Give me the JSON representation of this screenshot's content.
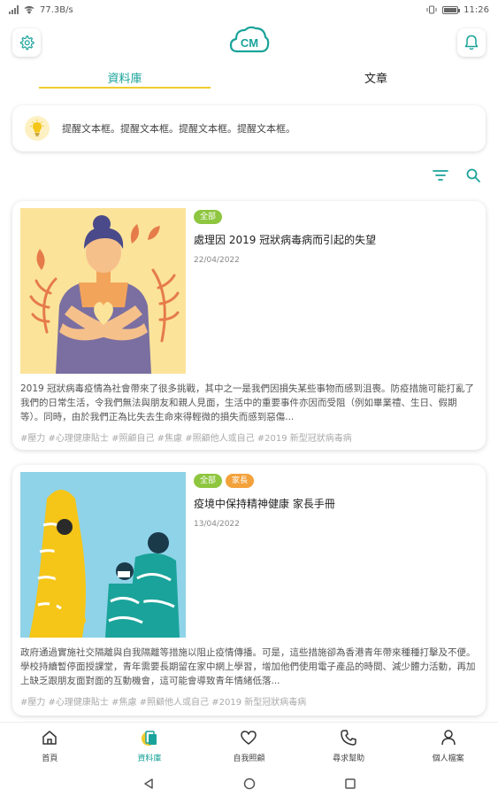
{
  "status_bar": {
    "network_speed": "77.3B/s",
    "time": "11:26"
  },
  "header": {
    "logo_text": "CM"
  },
  "tabs": [
    {
      "label": "資料庫",
      "active": true
    },
    {
      "label": "文章",
      "active": false
    }
  ],
  "reminder": {
    "text": "提醒文本框。提醒文本框。提醒文本框。提醒文本框。"
  },
  "cards": [
    {
      "tags": [
        "全部"
      ],
      "title": "處理因 2019 冠狀病毒病而引起的失望",
      "date": "22/04/2022",
      "description": "2019 冠狀病毒疫情為社會帶來了很多挑戰，其中之一是我們因損失某些事物而感到沮喪。防疫措施可能打亂了我們的日常生活，令我們無法與朋友和親人見面，生活中的重要事件亦因而受阻（例如畢業禮、生日、假期等）。同時，由於我們正為比失去生命來得輕微的損失而感到惡傷...",
      "hashtags": "#壓力 #心理健康貼士 #照顧自己 #焦慮 #照顧他人或自己 #2019 新型冠狀病毒病"
    },
    {
      "tags": [
        "全部",
        "家長"
      ],
      "title": "疫境中保持精神健康 家長手冊",
      "date": "13/04/2022",
      "description": "政府通過實施社交隔離與自我隔離等措施以阻止疫情傳播。可是，這些措施卻為香港青年帶來種種打擊及不便。學校持續暫停面授課堂，青年需要長期留在家中網上學習，增加他們使用電子產品的時間、減少體力活動，再加上缺乏跟朋友面對面的互動機會，這可能會導致青年情緒低落...",
      "hashtags": "#壓力 #心理健康貼士 #焦慮 #照顧他人或自己 #2019 新型冠狀病毒病"
    }
  ],
  "bottom_nav": [
    {
      "label": "首頁",
      "icon": "home-icon",
      "active": false
    },
    {
      "label": "資料庫",
      "icon": "database-icon",
      "active": true
    },
    {
      "label": "自我照顧",
      "icon": "heart-icon",
      "active": false
    },
    {
      "label": "尋求幫助",
      "icon": "phone-icon",
      "active": false
    },
    {
      "label": "個人檔案",
      "icon": "person-icon",
      "active": false
    }
  ],
  "colors": {
    "accent": "#1aa39a",
    "highlight": "#f0cb2b",
    "tag_green": "#8ec63f",
    "tag_orange": "#f3a13b"
  }
}
